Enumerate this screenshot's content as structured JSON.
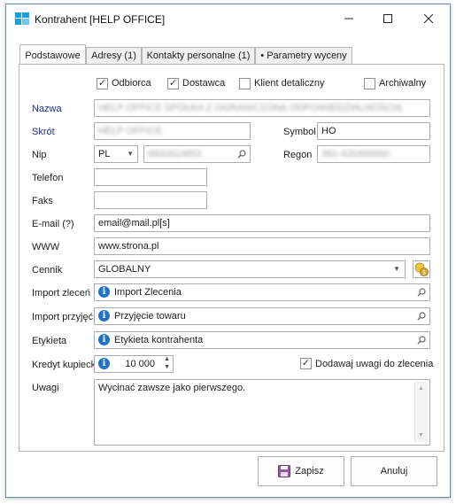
{
  "window": {
    "title": "Kontrahent [HELP OFFICE]",
    "minimize_icon": "minimize-icon",
    "maximize_icon": "maximize-icon",
    "close_icon": "close-icon"
  },
  "tabs": [
    {
      "label": "Podstawowe",
      "active": true
    },
    {
      "label": "Adresy (1)",
      "active": false
    },
    {
      "label": "Kontakty personalne (1)",
      "active": false
    },
    {
      "label": "• Parametry wyceny",
      "active": false
    }
  ],
  "checkboxes": {
    "odbiorca": {
      "label": "Odbiorca",
      "checked": true
    },
    "dostawca": {
      "label": "Dostawca",
      "checked": true
    },
    "klient": {
      "label": "Klient detaliczny",
      "checked": false
    },
    "archiwalny": {
      "label": "Archiwalny",
      "checked": false
    }
  },
  "labels": {
    "nazwa": "Nazwa",
    "skrot": "Skrót",
    "symbol": "Symbol",
    "nip": "Nip",
    "regon": "Regon",
    "telefon": "Telefon",
    "faks": "Faks",
    "email": "E-mail (?)",
    "www": "WWW",
    "cennik": "Cennik",
    "import_zlecen": "Import zleceń",
    "import_przyjec": "Import przyjęć",
    "etykieta": "Etykieta",
    "kredyt": "Kredyt kupiecki",
    "uwagi": "Uwagi"
  },
  "values": {
    "nazwa": "HELP OFFICE SPÓŁKA Z OGRANICZONĄ ODPOWIEDZIALNOŚCIĄ",
    "skrot": "HELP OFFICE",
    "symbol": "HO",
    "nip_prefix": "PL",
    "nip": "6832614651",
    "regon": "361-420490000",
    "telefon": "",
    "faks": "",
    "email": "email@mail.pl[s]",
    "www": "www.strona.pl",
    "cennik": "GLOBALNY",
    "import_zlecen": "Import Zlecenia",
    "import_przyjec": "Przyjęcie towaru",
    "etykieta": "Etykieta kontrahenta",
    "kredyt": "10 000",
    "dodawaj_uwagi_label": "Dodawaj uwagi do zlecenia",
    "dodawaj_uwagi_checked": true,
    "uwagi": "Wycinać zawsze jako pierwszego."
  },
  "buttons": {
    "save": "Zapisz",
    "cancel": "Anuluj"
  },
  "colors": {
    "accent_blue": "#1c2e8c",
    "info_blue": "#1f74c5",
    "border": "#abadb3"
  }
}
